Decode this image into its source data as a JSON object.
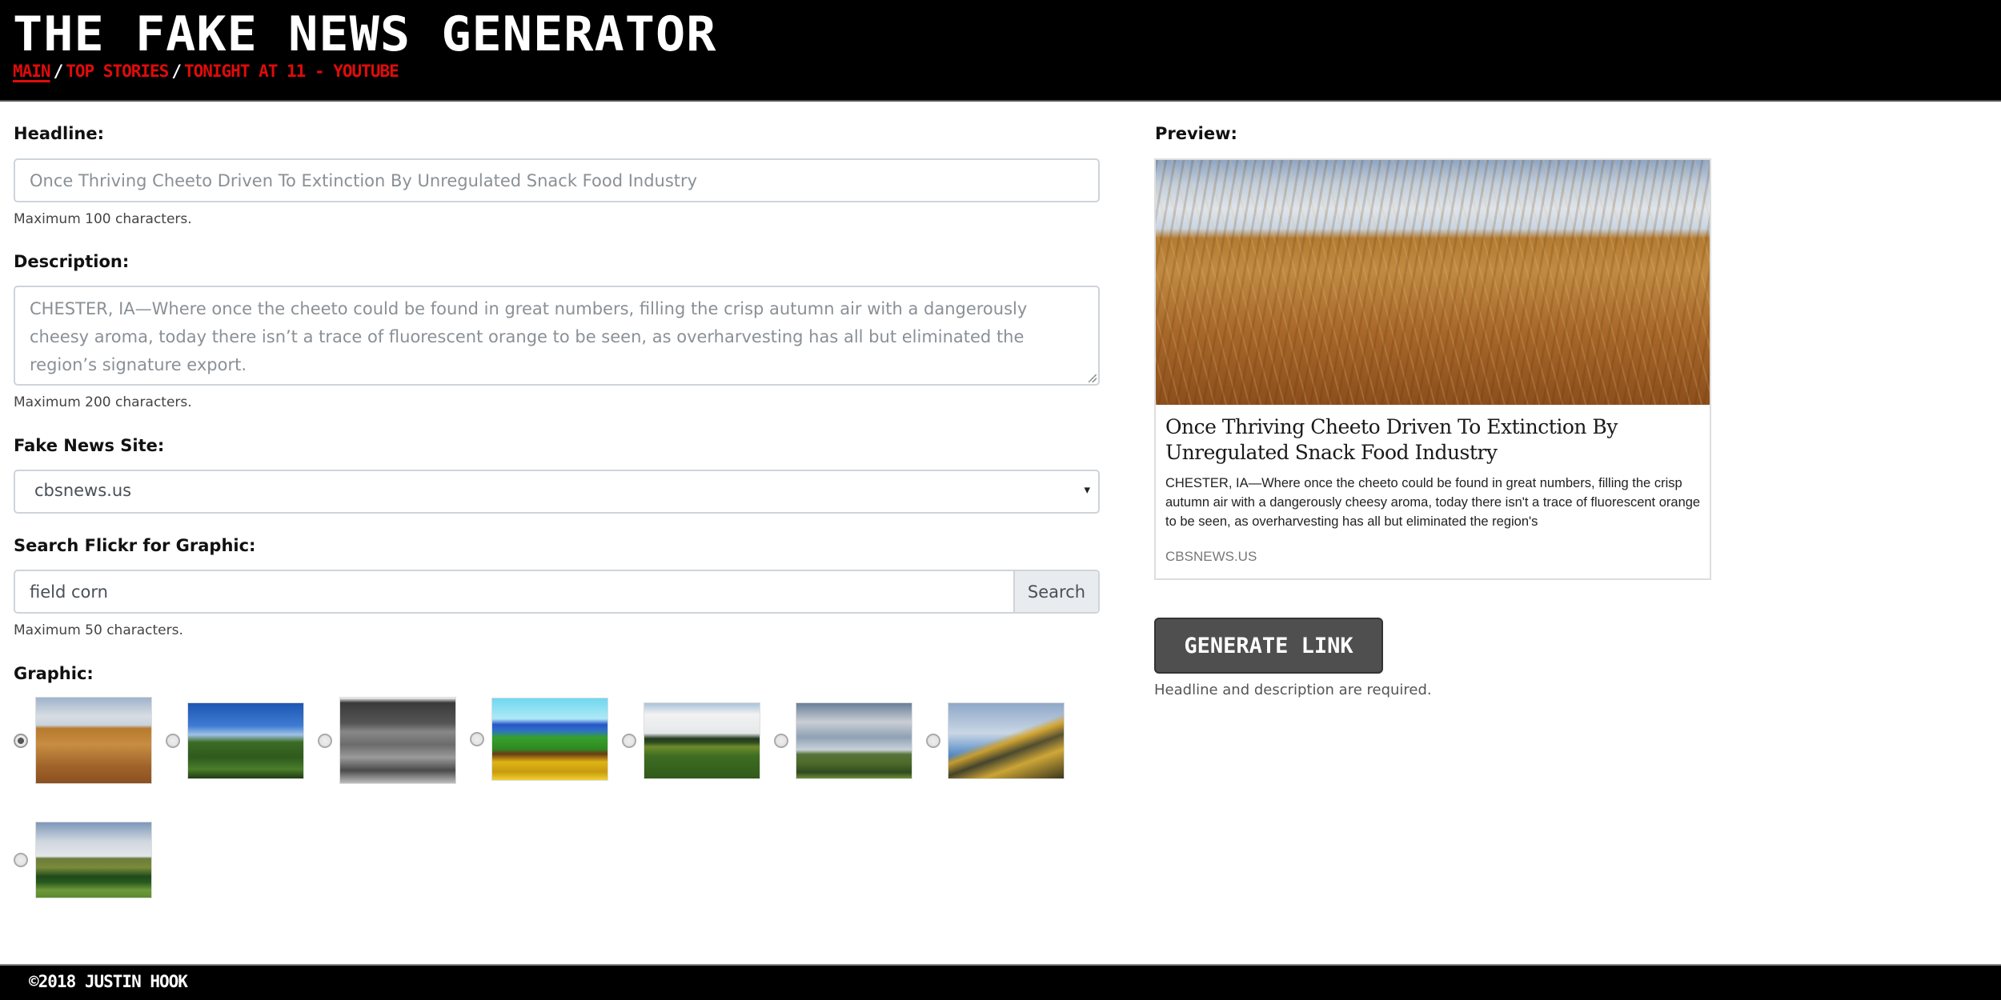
{
  "header": {
    "title": "The Fake News Generator",
    "nav": [
      {
        "label": "Main",
        "active": true
      },
      {
        "label": "Top Stories",
        "active": false
      },
      {
        "label": "Tonight at 11 - YouTube",
        "active": false
      }
    ],
    "nav_separator": "/"
  },
  "form": {
    "headline": {
      "label": "Headline:",
      "value": "",
      "placeholder": "Once Thriving Cheeto Driven To Extinction By Unregulated Snack Food Industry",
      "help": "Maximum 100 characters."
    },
    "description": {
      "label": "Description:",
      "value": "",
      "placeholder": "CHESTER, IA—Where once the cheeto could be found in great numbers, filling the crisp autumn air with a dangerously cheesy aroma, today there isn’t a trace of fluorescent orange to be seen, as overharvesting has all but eliminated the region’s signature export.",
      "help": "Maximum 200 characters."
    },
    "site": {
      "label": "Fake News Site:",
      "selected": "cbsnews.us",
      "caret": "▾"
    },
    "flickr_search": {
      "label": "Search Flickr for Graphic:",
      "value": "field corn",
      "button_label": "Search",
      "help": "Maximum 50 characters."
    },
    "graphic": {
      "label": "Graphic:",
      "selected_index": 0,
      "options": [
        {
          "description": "wheat field under cloudy sky"
        },
        {
          "description": "corn stalks against blue sky"
        },
        {
          "description": "black and white corn field with trees"
        },
        {
          "description": "painting of corn field with blue mountains"
        },
        {
          "description": "corn field with clouds and treeline"
        },
        {
          "description": "corn field to horizon with cloudy sky"
        },
        {
          "description": "corn tassels against blue sky"
        },
        {
          "description": "green prairie field under cloudy sky"
        }
      ]
    }
  },
  "preview": {
    "label": "Preview:",
    "headline": "Once Thriving Cheeto Driven To Extinction By Unregulated Snack Food Industry",
    "description": "CHESTER, IA—Where once the cheeto could be found in great numbers, filling the crisp autumn air with a dangerously cheesy aroma, today there isn't a trace of fluorescent orange to be seen, as overharvesting has all but eliminated the region's",
    "site": "CBSNEWS.US"
  },
  "actions": {
    "generate_label": "Generate Link",
    "generate_hint": "Headline and description are required."
  },
  "footer": {
    "copyright": "©2018 Justin Hook"
  },
  "colors": {
    "header_bg": "#000000",
    "nav_link": "#e00b0b",
    "generate_button": "#4f4f4f"
  }
}
